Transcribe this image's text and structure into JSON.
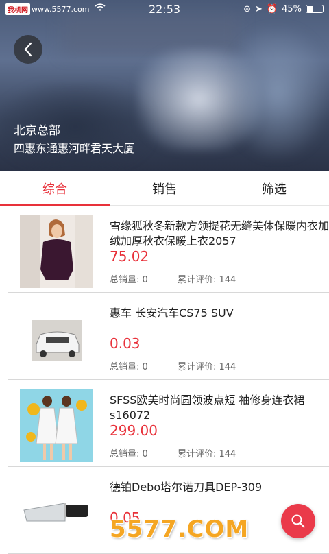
{
  "status_bar": {
    "carrier": "我机网",
    "carrier_url": "www.5577.com",
    "time": "22:53",
    "battery": "45%",
    "battery_level": 0.45
  },
  "header": {
    "title": "北京总部",
    "subtitle": "四惠东通惠河畔君天大厦"
  },
  "tabs": [
    {
      "label": "综合",
      "active": true
    },
    {
      "label": "销售",
      "active": false
    },
    {
      "label": "筛选",
      "active": false
    }
  ],
  "products": [
    {
      "title": "雪缘狐秋冬新款方领提花无缝美体保暖内衣加绒加厚秋衣保暖上衣2057",
      "price": "75.02",
      "sales": "总销量: 0",
      "reviews": "累计评价: 144"
    },
    {
      "title": "惠车 长安汽车CS75 SUV",
      "price": "0.03",
      "sales": "总销量: 0",
      "reviews": "累计评价: 144"
    },
    {
      "title": "SFSS欧美时尚圆领波点短 袖修身连衣裙s16072",
      "price": "299.00",
      "sales": "总销量: 0",
      "reviews": "累计评价: 144"
    },
    {
      "title": "德铂Debo塔尔诺刀具DEP-309",
      "price": "0.05",
      "sales": "",
      "reviews": ""
    }
  ],
  "watermark": "5577.COM",
  "colors": {
    "accent": "#e8313a",
    "fab": "#ea3a4a"
  },
  "icons": {
    "back": "chevron-left-icon",
    "search": "search-icon",
    "wifi": "wifi-icon"
  }
}
